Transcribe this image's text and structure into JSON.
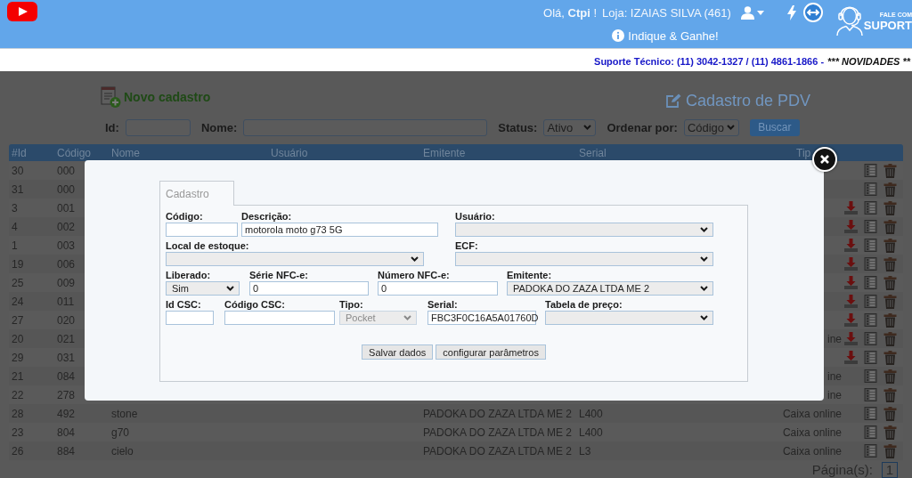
{
  "header": {
    "greeting": "Olá, **Ctpi** !",
    "store": "Loja: IZAIAS SILVA (461)",
    "promo_link": "Indique & Ganhe!",
    "support_badge": {
      "line_1": "FALE COM",
      "line_2": "SUPORT"
    }
  },
  "support_bar": {
    "phones": "Suporte Técnico: (11) 3042-1327 / (11) 4861-1866 -",
    "news": "*** NOVIDADES **"
  },
  "page": {
    "new_link": "Novo cadastro",
    "title": "Cadastro de PDV"
  },
  "filters": {
    "fields": [
      {
        "label": "Id:",
        "kind": "input"
      },
      {
        "label": "Nome:",
        "kind": "input"
      },
      {
        "label": "Status:",
        "kind": "select",
        "value": "Ativo"
      },
      {
        "label": "Ordenar por:",
        "kind": "select",
        "value": "Código"
      }
    ],
    "search_button": "Buscar"
  },
  "table": {
    "columns": [
      "#Id",
      "Código",
      "Nome",
      "Usuário",
      "Emitente",
      "Serial",
      "Tip"
    ],
    "rows": [
      {
        "id": "30",
        "code": "000",
        "download": false
      },
      {
        "id": "31",
        "code": "000",
        "download": false
      },
      {
        "id": "3",
        "code": "001",
        "download": true
      },
      {
        "id": "4",
        "code": "002",
        "download": true
      },
      {
        "id": "1",
        "code": "003",
        "download": true
      },
      {
        "id": "19",
        "code": "006",
        "download": true
      },
      {
        "id": "25",
        "code": "009",
        "download": true
      },
      {
        "id": "24",
        "code": "011",
        "download": true
      },
      {
        "id": "27",
        "code": "020",
        "download": true
      },
      {
        "id": "20",
        "code": "021",
        "type": "ine",
        "download": true
      },
      {
        "id": "29",
        "code": "031",
        "download": true
      },
      {
        "id": "21",
        "code": "084",
        "type": "ine",
        "download": false
      },
      {
        "id": "22",
        "code": "278",
        "type": "ine",
        "download": false
      },
      {
        "id": "28",
        "code": "492",
        "name": "stone",
        "issuer": "PADOKA DO ZAZA LTDA ME 2",
        "serial": "L400",
        "type": "Caixa online",
        "download": false
      },
      {
        "id": "23",
        "code": "804",
        "name": "g70",
        "issuer": "PADOKA DO ZAZA LTDA ME 2",
        "serial": "L400",
        "type": "Caixa online",
        "download": false
      },
      {
        "id": "26",
        "code": "884",
        "name": "cielo",
        "issuer": "PADOKA DO ZAZA LTDA ME 2",
        "serial": "L3",
        "type": "Caixa online",
        "download": false
      }
    ]
  },
  "pagination": {
    "label": "Página(s):",
    "pages": [
      {
        "label": "1",
        "selected": true
      }
    ]
  },
  "modal": {
    "tabs": [
      {
        "label": "Cadastro",
        "selected": true
      }
    ],
    "rows": [
      [
        {
          "label": "Código:",
          "kind": "input",
          "disabled": false
        },
        {
          "label": "Descrição:",
          "kind": "input",
          "value": "motorola moto g73 5G",
          "disabled": false
        },
        {
          "label": "Usuário:",
          "kind": "select",
          "disabled": false
        }
      ],
      [
        {
          "label": "Local de estoque:",
          "kind": "select",
          "disabled": false
        },
        {
          "label": "ECF:",
          "kind": "select",
          "disabled": false
        }
      ],
      [
        {
          "label": "Liberado:",
          "kind": "select",
          "value": "Sim",
          "disabled": false
        },
        {
          "label": "Série NFC-e:",
          "kind": "input",
          "value": "0",
          "disabled": false
        },
        {
          "label": "Número NFC-e:",
          "kind": "input",
          "value": "0",
          "disabled": false
        },
        {
          "label": "Emitente:",
          "kind": "select",
          "value": "PADOKA DO ZAZA LTDA ME 2",
          "disabled": false
        }
      ],
      [
        {
          "label": "Id CSC:",
          "kind": "input",
          "disabled": false
        },
        {
          "label": "Código CSC:",
          "kind": "input",
          "disabled": false
        },
        {
          "label": "Tipo:",
          "kind": "select",
          "value": "Pocket",
          "disabled": true
        },
        {
          "label": "Serial:",
          "kind": "input",
          "value": "FBC3F0C16A5A01760D",
          "disabled": false
        },
        {
          "label": "Tabela de preço:",
          "kind": "select",
          "disabled": false
        }
      ]
    ],
    "buttons": [
      "Salvar dados",
      "configurar parâmetros"
    ]
  }
}
